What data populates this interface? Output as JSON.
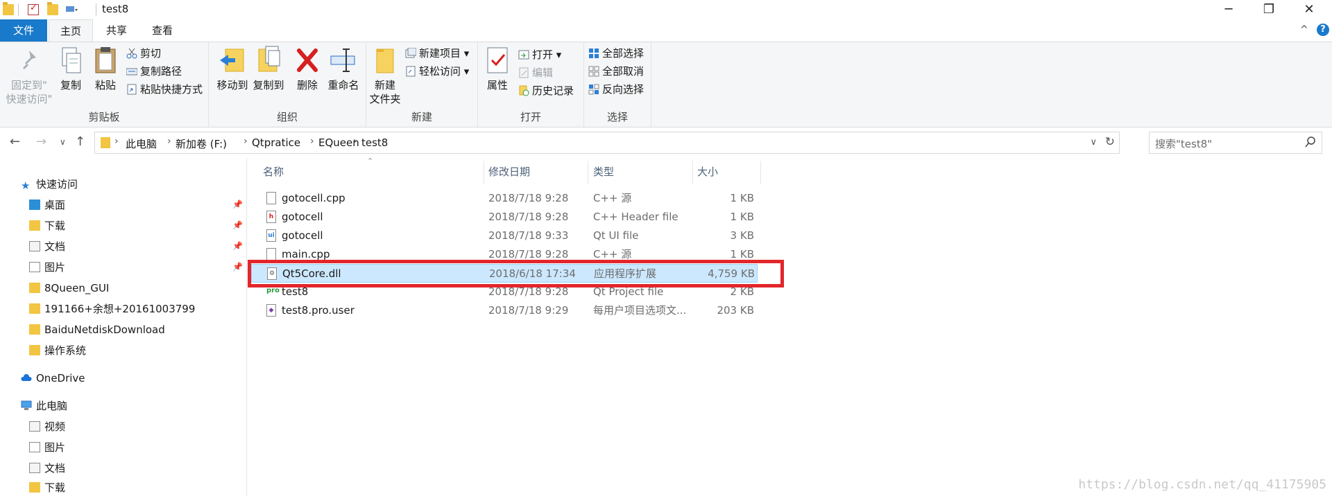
{
  "window": {
    "title": "test8",
    "controls": {
      "minimize": "─",
      "maximize": "❐",
      "close": "✕"
    }
  },
  "ribbon_tabs": {
    "file": "文件",
    "home": "主页",
    "share": "共享",
    "view": "查看",
    "collapse": "^",
    "help": "?"
  },
  "ribbon": {
    "clipboard": {
      "group_label": "剪贴板",
      "pin_label_1": "固定到\"",
      "pin_label_2": "快速访问\"",
      "copy": "复制",
      "paste": "粘贴",
      "cut": "剪切",
      "copy_path": "复制路径",
      "paste_shortcut": "粘贴快捷方式"
    },
    "organize": {
      "group_label": "组织",
      "move_to": "移动到",
      "copy_to": "复制到",
      "delete": "删除",
      "rename": "重命名"
    },
    "new": {
      "group_label": "新建",
      "new_folder_1": "新建",
      "new_folder_2": "文件夹",
      "new_item": "新建项目",
      "easy_access": "轻松访问"
    },
    "open": {
      "group_label": "打开",
      "properties": "属性",
      "open": "打开",
      "edit": "编辑",
      "history": "历史记录"
    },
    "select": {
      "group_label": "选择",
      "select_all": "全部选择",
      "select_none": "全部取消",
      "invert": "反向选择"
    }
  },
  "address": {
    "crumbs": [
      "此电脑",
      "新加卷 (F:)",
      "Qtpratice",
      "EQueen",
      "test8"
    ],
    "search_placeholder": "搜索\"test8\""
  },
  "nav_pane": {
    "quick_access": "快速访问",
    "quick_items": [
      "桌面",
      "下载",
      "文档",
      "图片",
      "8Queen_GUI",
      "191166+余想+20161003799",
      "BaiduNetdiskDownload",
      "操作系统"
    ],
    "onedrive": "OneDrive",
    "this_pc": "此电脑",
    "pc_items": [
      "视频",
      "图片",
      "文档",
      "下载"
    ]
  },
  "columns": {
    "name": "名称",
    "date": "修改日期",
    "type": "类型",
    "size": "大小"
  },
  "files": [
    {
      "name": "gotocell.cpp",
      "date": "2018/7/18 9:28",
      "type": "C++ 源",
      "size": "1 KB",
      "icon": "cpp-file-icon"
    },
    {
      "name": "gotocell",
      "date": "2018/7/18 9:28",
      "type": "C++ Header file",
      "size": "1 KB",
      "icon": "header-file-icon"
    },
    {
      "name": "gotocell",
      "date": "2018/7/18 9:33",
      "type": "Qt UI file",
      "size": "3 KB",
      "icon": "ui-file-icon"
    },
    {
      "name": "main.cpp",
      "date": "2018/7/18 9:28",
      "type": "C++ 源",
      "size": "1 KB",
      "icon": "cpp-file-icon"
    },
    {
      "name": "Qt5Core.dll",
      "date": "2018/6/18 17:34",
      "type": "应用程序扩展",
      "size": "4,759 KB",
      "icon": "dll-file-icon"
    },
    {
      "name": "test8",
      "date": "2018/7/18 9:28",
      "type": "Qt Project file",
      "size": "2 KB",
      "icon": "pro-file-icon"
    },
    {
      "name": "test8.pro.user",
      "date": "2018/7/18 9:29",
      "type": "每用户项目选项文...",
      "size": "203 KB",
      "icon": "user-file-icon"
    }
  ],
  "selected_file": "Qt5Core.dll",
  "watermark": "https://blog.csdn.net/qq_41175905"
}
